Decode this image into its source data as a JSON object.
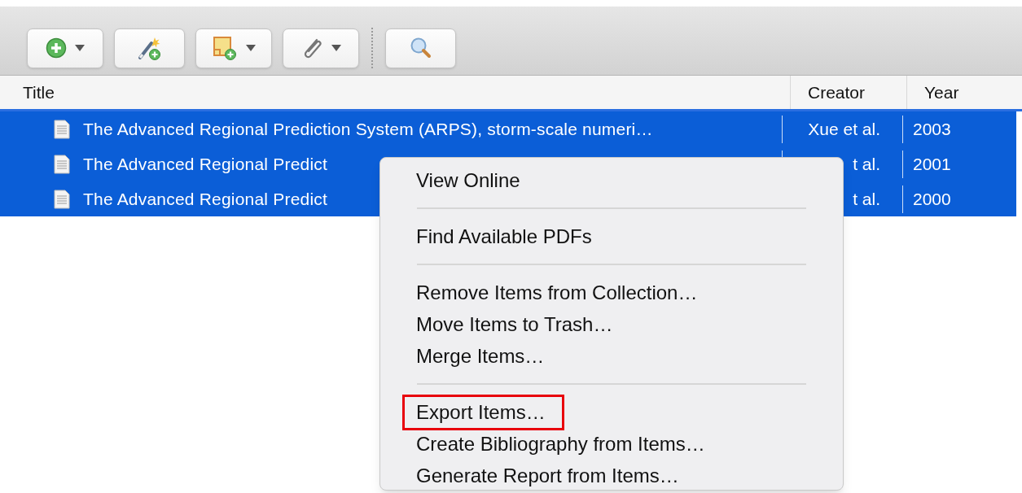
{
  "toolbar": [
    {
      "kind": "new-item",
      "dropdown": true
    },
    {
      "kind": "wand",
      "dropdown": false
    },
    {
      "kind": "note",
      "dropdown": true
    },
    {
      "kind": "attach",
      "dropdown": true
    },
    {
      "kind": "separator"
    },
    {
      "kind": "search",
      "dropdown": false
    }
  ],
  "table": {
    "columns": [
      "Title",
      "Creator",
      "Year"
    ],
    "rows": [
      {
        "title": "The Advanced Regional Prediction System (ARPS), storm-scale numeri…",
        "creator": "Xue et al.",
        "year": "2003",
        "selected": true
      },
      {
        "title": "The Advanced Regional Predict",
        "creator": "t al.",
        "year": "2001",
        "selected": true
      },
      {
        "title": "The Advanced Regional Predict",
        "creator": "t al.",
        "year": "2000",
        "selected": true
      }
    ]
  },
  "context_menu": {
    "groups": [
      [
        {
          "label": "View Online",
          "highlighted": false
        }
      ],
      [
        {
          "label": "Find Available PDFs",
          "highlighted": false
        }
      ],
      [
        {
          "label": "Remove Items from Collection…",
          "highlighted": false
        },
        {
          "label": "Move Items to Trash…",
          "highlighted": false
        },
        {
          "label": "Merge Items…",
          "highlighted": false
        }
      ],
      [
        {
          "label": "Export Items…",
          "highlighted": true
        },
        {
          "label": "Create Bibliography from Items…",
          "highlighted": false
        },
        {
          "label": "Generate Report from Items…",
          "highlighted": false
        }
      ]
    ]
  }
}
